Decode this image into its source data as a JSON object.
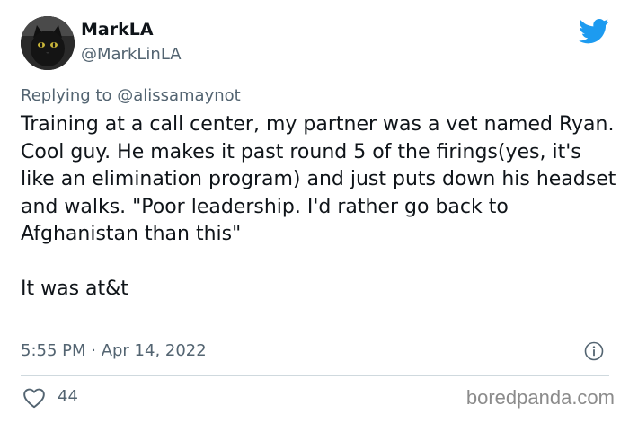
{
  "author": {
    "display_name": "MarkLA",
    "handle": "@MarkLinLA",
    "avatar_icon": "black-cat-avatar"
  },
  "brand": {
    "icon": "twitter-bird-icon",
    "color": "#1d9bf0"
  },
  "reply": {
    "prefix": "Replying to ",
    "mention": "@alissamaynot"
  },
  "content": {
    "paragraph_1": "Training at a call center, my partner was a vet named Ryan. Cool guy. He makes it past round 5 of the firings(yes, it's like an elimination program) and just puts down his headset and walks. \"Poor leadership. I'd rather go back to Afghanistan than this\"",
    "paragraph_2": "It was at&t"
  },
  "meta": {
    "timestamp": "5:55 PM · Apr 14, 2022"
  },
  "engagement": {
    "likes": "44"
  },
  "watermark": "boredpanda.com",
  "colors": {
    "text_primary": "#0f1419",
    "text_secondary": "#536471",
    "divider": "#cfd9de",
    "watermark": "#8b8b8b"
  }
}
